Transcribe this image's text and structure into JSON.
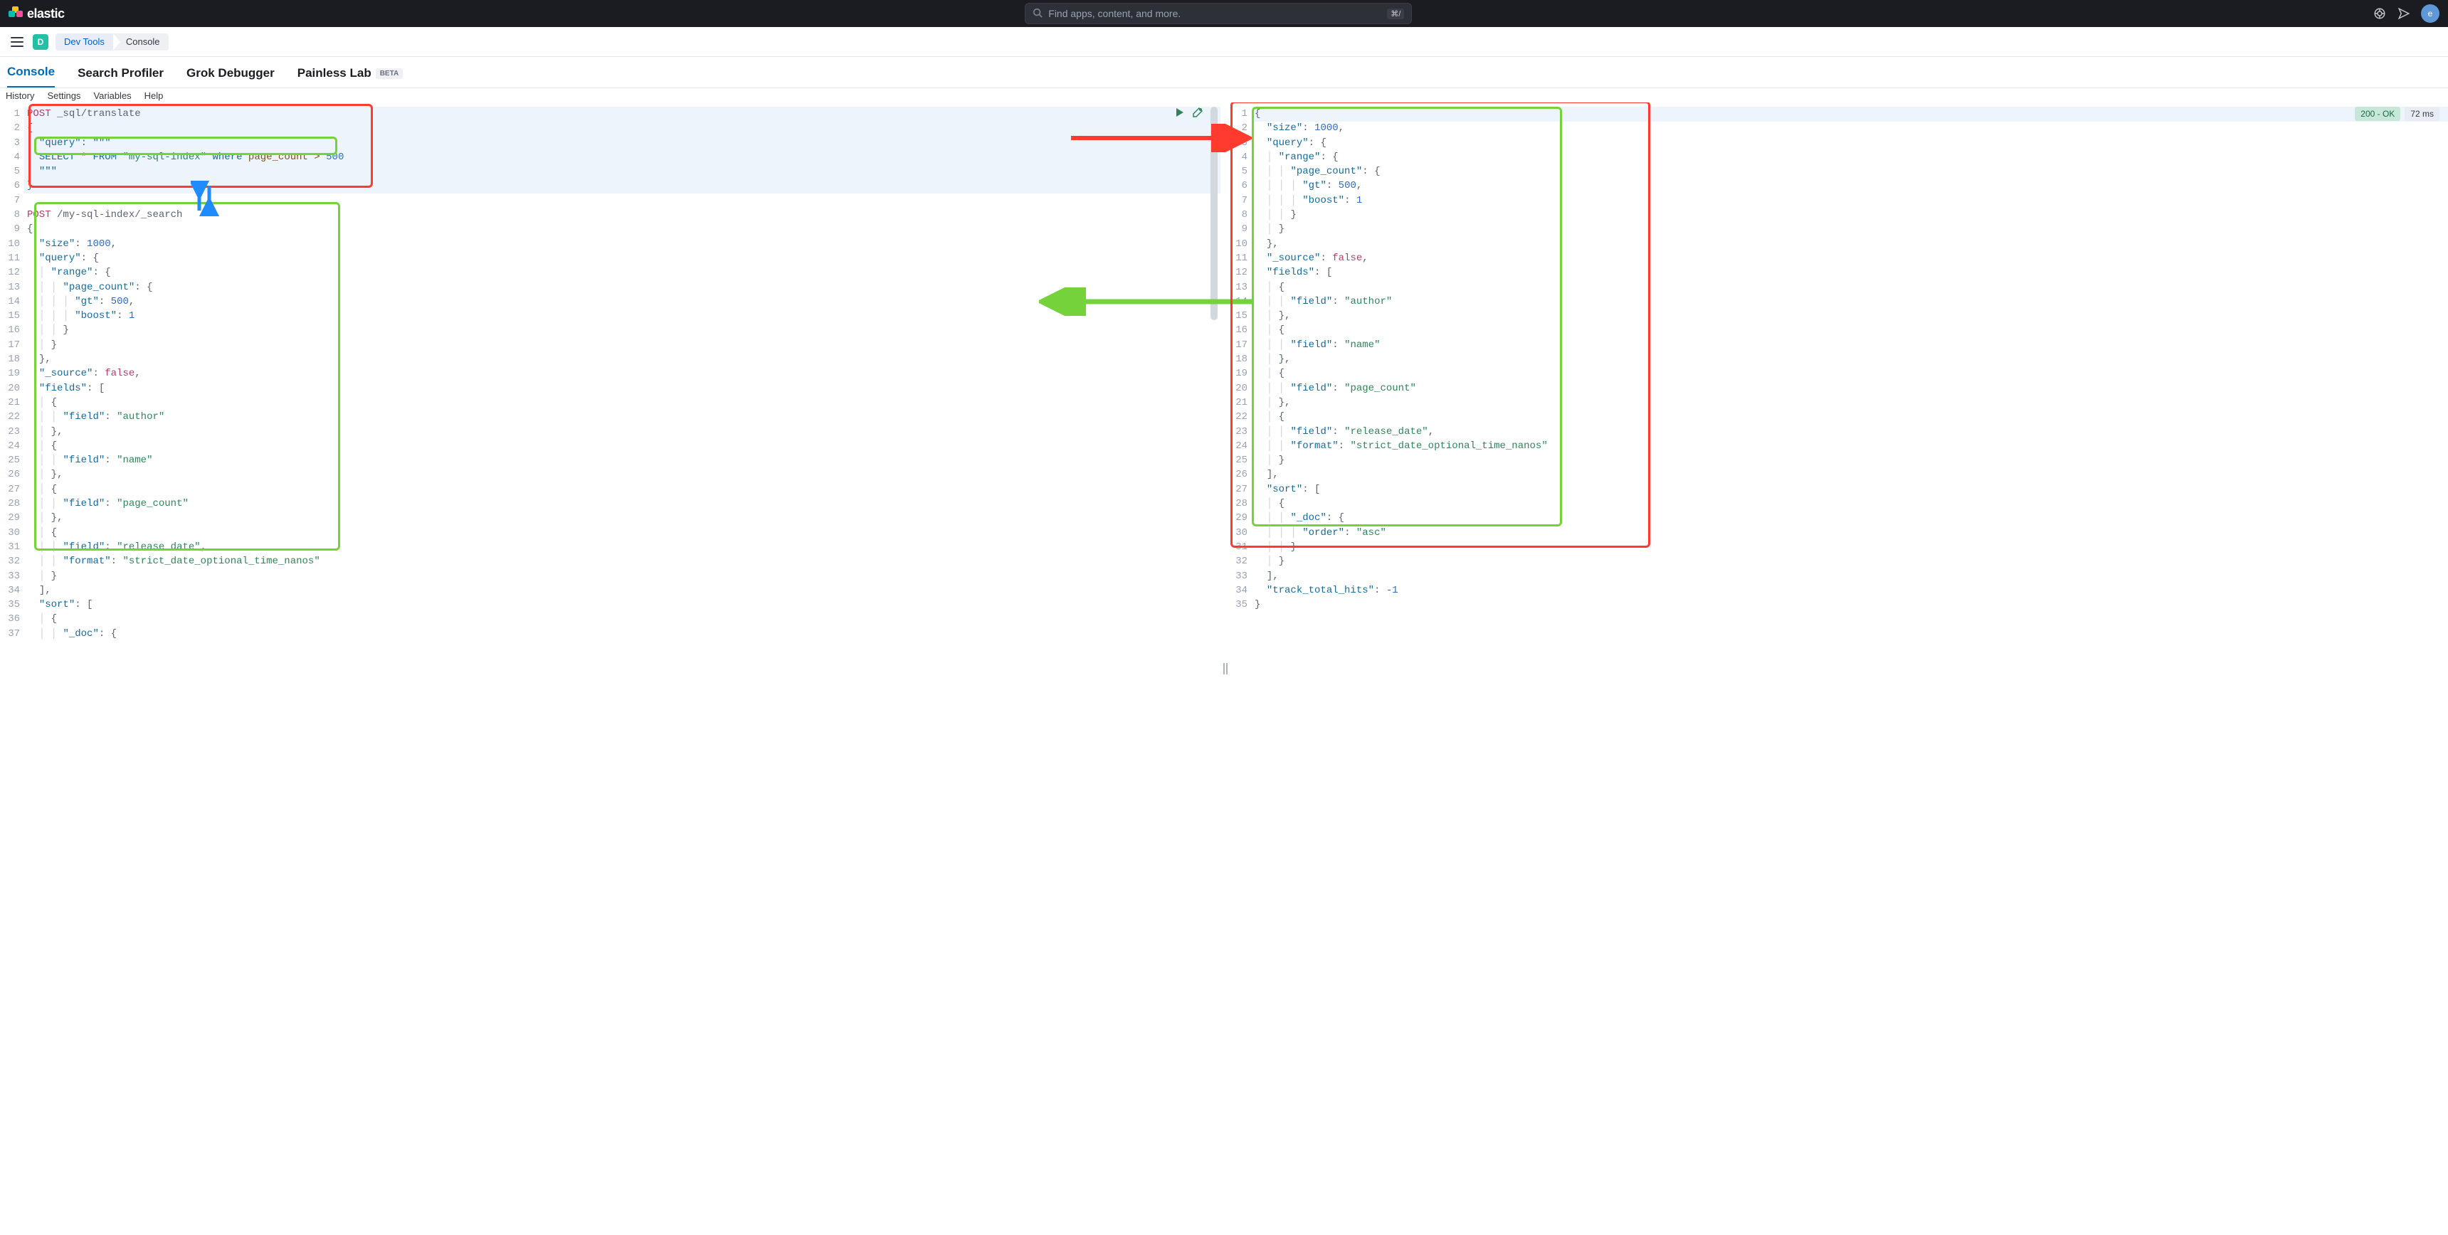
{
  "topbar": {
    "brand": "elastic",
    "search_placeholder": "Find apps, content, and more.",
    "kbd": "⌘/",
    "avatar_initial": "e"
  },
  "crumb": {
    "space_initial": "D",
    "devtools": "Dev Tools",
    "console": "Console"
  },
  "tabs": {
    "console": "Console",
    "profiler": "Search Profiler",
    "grok": "Grok Debugger",
    "painless": "Painless Lab",
    "beta": "BETA"
  },
  "subnav": {
    "history": "History",
    "settings": "Settings",
    "variables": "Variables",
    "help": "Help"
  },
  "status": {
    "code": "200 - OK",
    "time": "72 ms"
  },
  "editor_left": {
    "lines": [
      {
        "n": "1",
        "html": "<span class='tok-method'>POST</span> <span class='tok-url'>_sql/translate</span>"
      },
      {
        "n": "2",
        "html": "<span class='tok-brace'>{</span>"
      },
      {
        "n": "3",
        "html": "  <span class='tok-key'>\"query\"</span><span class='tok-punc'>:</span> <span class='tok-str'>\"\"\"</span>"
      },
      {
        "n": "4",
        "html": "  <span class='tok-kw'>SELECT</span> <span class='tok-op'>*</span> <span class='tok-kw'>FROM</span> <span class='tok-strg'>\"my-sql-index\"</span> <span class='tok-kw'>where</span> <span class='tok-ident'>page_count</span> <span class='tok-op'>&gt;</span> <span class='tok-num'>500</span>"
      },
      {
        "n": "5",
        "html": "  <span class='tok-str'>\"\"\"</span>"
      },
      {
        "n": "6",
        "html": "<span class='tok-brace'>}</span>"
      },
      {
        "n": "7",
        "html": ""
      },
      {
        "n": "8",
        "html": "<span class='tok-method'>POST</span> <span class='tok-url'>/my-sql-index/_search</span>"
      },
      {
        "n": "9",
        "html": "<span class='tok-brace'>{</span>"
      },
      {
        "n": "10",
        "html": "  <span class='tok-key'>\"size\"</span><span class='tok-punc'>:</span> <span class='tok-num'>1000</span><span class='tok-punc'>,</span>"
      },
      {
        "n": "11",
        "html": "  <span class='tok-key'>\"query\"</span><span class='tok-punc'>:</span> <span class='tok-brace'>{</span>"
      },
      {
        "n": "12",
        "html": "  <span class='guide'>│</span> <span class='tok-key'>\"range\"</span><span class='tok-punc'>:</span> <span class='tok-brace'>{</span>"
      },
      {
        "n": "13",
        "html": "  <span class='guide'>│</span> <span class='guide'>│</span> <span class='tok-key'>\"page_count\"</span><span class='tok-punc'>:</span> <span class='tok-brace'>{</span>"
      },
      {
        "n": "14",
        "html": "  <span class='guide'>│</span> <span class='guide'>│</span> <span class='guide'>│</span> <span class='tok-key'>\"gt\"</span><span class='tok-punc'>:</span> <span class='tok-num'>500</span><span class='tok-punc'>,</span>"
      },
      {
        "n": "15",
        "html": "  <span class='guide'>│</span> <span class='guide'>│</span> <span class='guide'>│</span> <span class='tok-key'>\"boost\"</span><span class='tok-punc'>:</span> <span class='tok-num'>1</span>"
      },
      {
        "n": "16",
        "html": "  <span class='guide'>│</span> <span class='guide'>│</span> <span class='tok-brace'>}</span>"
      },
      {
        "n": "17",
        "html": "  <span class='guide'>│</span> <span class='tok-brace'>}</span>"
      },
      {
        "n": "18",
        "html": "  <span class='tok-brace'>}</span><span class='tok-punc'>,</span>"
      },
      {
        "n": "19",
        "html": "  <span class='tok-key'>\"_source\"</span><span class='tok-punc'>:</span> <span class='tok-bool'>false</span><span class='tok-punc'>,</span>"
      },
      {
        "n": "20",
        "html": "  <span class='tok-key'>\"fields\"</span><span class='tok-punc'>:</span> <span class='tok-brace'>[</span>"
      },
      {
        "n": "21",
        "html": "  <span class='guide'>│</span> <span class='tok-brace'>{</span>"
      },
      {
        "n": "22",
        "html": "  <span class='guide'>│</span> <span class='guide'>│</span> <span class='tok-key'>\"field\"</span><span class='tok-punc'>:</span> <span class='tok-strg'>\"author\"</span>"
      },
      {
        "n": "23",
        "html": "  <span class='guide'>│</span> <span class='tok-brace'>}</span><span class='tok-punc'>,</span>"
      },
      {
        "n": "24",
        "html": "  <span class='guide'>│</span> <span class='tok-brace'>{</span>"
      },
      {
        "n": "25",
        "html": "  <span class='guide'>│</span> <span class='guide'>│</span> <span class='tok-key'>\"field\"</span><span class='tok-punc'>:</span> <span class='tok-strg'>\"name\"</span>"
      },
      {
        "n": "26",
        "html": "  <span class='guide'>│</span> <span class='tok-brace'>}</span><span class='tok-punc'>,</span>"
      },
      {
        "n": "27",
        "html": "  <span class='guide'>│</span> <span class='tok-brace'>{</span>"
      },
      {
        "n": "28",
        "html": "  <span class='guide'>│</span> <span class='guide'>│</span> <span class='tok-key'>\"field\"</span><span class='tok-punc'>:</span> <span class='tok-strg'>\"page_count\"</span>"
      },
      {
        "n": "29",
        "html": "  <span class='guide'>│</span> <span class='tok-brace'>}</span><span class='tok-punc'>,</span>"
      },
      {
        "n": "30",
        "html": "  <span class='guide'>│</span> <span class='tok-brace'>{</span>"
      },
      {
        "n": "31",
        "html": "  <span class='guide'>│</span> <span class='guide'>│</span> <span class='tok-key'>\"field\"</span><span class='tok-punc'>:</span> <span class='tok-strg'>\"release_date\"</span><span class='tok-punc'>,</span>"
      },
      {
        "n": "32",
        "html": "  <span class='guide'>│</span> <span class='guide'>│</span> <span class='tok-key'>\"format\"</span><span class='tok-punc'>:</span> <span class='tok-strg'>\"strict_date_optional_time_nanos\"</span>"
      },
      {
        "n": "33",
        "html": "  <span class='guide'>│</span> <span class='tok-brace'>}</span>"
      },
      {
        "n": "34",
        "html": "  <span class='tok-brace'>]</span><span class='tok-punc'>,</span>"
      },
      {
        "n": "35",
        "html": "  <span class='tok-key'>\"sort\"</span><span class='tok-punc'>:</span> <span class='tok-brace'>[</span>"
      },
      {
        "n": "36",
        "html": "  <span class='guide'>│</span> <span class='tok-brace'>{</span>"
      },
      {
        "n": "37",
        "html": "  <span class='guide'>│</span> <span class='guide'>│</span> <span class='tok-key'>\"_doc\"</span><span class='tok-punc'>:</span> <span class='tok-brace'>{</span>"
      }
    ]
  },
  "editor_right": {
    "lines": [
      {
        "n": "1",
        "html": "<span class='tok-brace'>{</span>"
      },
      {
        "n": "2",
        "html": "  <span class='tok-key'>\"size\"</span><span class='tok-punc'>:</span> <span class='tok-num'>1000</span><span class='tok-punc'>,</span>"
      },
      {
        "n": "3",
        "html": "  <span class='tok-key'>\"query\"</span><span class='tok-punc'>:</span> <span class='tok-brace'>{</span>"
      },
      {
        "n": "4",
        "html": "  <span class='guide'>│</span> <span class='tok-key'>\"range\"</span><span class='tok-punc'>:</span> <span class='tok-brace'>{</span>"
      },
      {
        "n": "5",
        "html": "  <span class='guide'>│</span> <span class='guide'>│</span> <span class='tok-key'>\"page_count\"</span><span class='tok-punc'>:</span> <span class='tok-brace'>{</span>"
      },
      {
        "n": "6",
        "html": "  <span class='guide'>│</span> <span class='guide'>│</span> <span class='guide'>│</span> <span class='tok-key'>\"gt\"</span><span class='tok-punc'>:</span> <span class='tok-num'>500</span><span class='tok-punc'>,</span>"
      },
      {
        "n": "7",
        "html": "  <span class='guide'>│</span> <span class='guide'>│</span> <span class='guide'>│</span> <span class='tok-key'>\"boost\"</span><span class='tok-punc'>:</span> <span class='tok-num'>1</span>"
      },
      {
        "n": "8",
        "html": "  <span class='guide'>│</span> <span class='guide'>│</span> <span class='tok-brace'>}</span>"
      },
      {
        "n": "9",
        "html": "  <span class='guide'>│</span> <span class='tok-brace'>}</span>"
      },
      {
        "n": "10",
        "html": "  <span class='tok-brace'>}</span><span class='tok-punc'>,</span>"
      },
      {
        "n": "11",
        "html": "  <span class='tok-key'>\"_source\"</span><span class='tok-punc'>:</span> <span class='tok-bool'>false</span><span class='tok-punc'>,</span>"
      },
      {
        "n": "12",
        "html": "  <span class='tok-key'>\"fields\"</span><span class='tok-punc'>:</span> <span class='tok-brace'>[</span>"
      },
      {
        "n": "13",
        "html": "  <span class='guide'>│</span> <span class='tok-brace'>{</span>"
      },
      {
        "n": "14",
        "html": "  <span class='guide'>│</span> <span class='guide'>│</span> <span class='tok-key'>\"field\"</span><span class='tok-punc'>:</span> <span class='tok-strg'>\"author\"</span>"
      },
      {
        "n": "15",
        "html": "  <span class='guide'>│</span> <span class='tok-brace'>}</span><span class='tok-punc'>,</span>"
      },
      {
        "n": "16",
        "html": "  <span class='guide'>│</span> <span class='tok-brace'>{</span>"
      },
      {
        "n": "17",
        "html": "  <span class='guide'>│</span> <span class='guide'>│</span> <span class='tok-key'>\"field\"</span><span class='tok-punc'>:</span> <span class='tok-strg'>\"name\"</span>"
      },
      {
        "n": "18",
        "html": "  <span class='guide'>│</span> <span class='tok-brace'>}</span><span class='tok-punc'>,</span>"
      },
      {
        "n": "19",
        "html": "  <span class='guide'>│</span> <span class='tok-brace'>{</span>"
      },
      {
        "n": "20",
        "html": "  <span class='guide'>│</span> <span class='guide'>│</span> <span class='tok-key'>\"field\"</span><span class='tok-punc'>:</span> <span class='tok-strg'>\"page_count\"</span>"
      },
      {
        "n": "21",
        "html": "  <span class='guide'>│</span> <span class='tok-brace'>}</span><span class='tok-punc'>,</span>"
      },
      {
        "n": "22",
        "html": "  <span class='guide'>│</span> <span class='tok-brace'>{</span>"
      },
      {
        "n": "23",
        "html": "  <span class='guide'>│</span> <span class='guide'>│</span> <span class='tok-key'>\"field\"</span><span class='tok-punc'>:</span> <span class='tok-strg'>\"release_date\"</span><span class='tok-punc'>,</span>"
      },
      {
        "n": "24",
        "html": "  <span class='guide'>│</span> <span class='guide'>│</span> <span class='tok-key'>\"format\"</span><span class='tok-punc'>:</span> <span class='tok-strg'>\"strict_date_optional_time_nanos\"</span>"
      },
      {
        "n": "25",
        "html": "  <span class='guide'>│</span> <span class='tok-brace'>}</span>"
      },
      {
        "n": "26",
        "html": "  <span class='tok-brace'>]</span><span class='tok-punc'>,</span>"
      },
      {
        "n": "27",
        "html": "  <span class='tok-key'>\"sort\"</span><span class='tok-punc'>:</span> <span class='tok-brace'>[</span>"
      },
      {
        "n": "28",
        "html": "  <span class='guide'>│</span> <span class='tok-brace'>{</span>"
      },
      {
        "n": "29",
        "html": "  <span class='guide'>│</span> <span class='guide'>│</span> <span class='tok-key'>\"_doc\"</span><span class='tok-punc'>:</span> <span class='tok-brace'>{</span>"
      },
      {
        "n": "30",
        "html": "  <span class='guide'>│</span> <span class='guide'>│</span> <span class='guide'>│</span> <span class='tok-key'>\"order\"</span><span class='tok-punc'>:</span> <span class='tok-strg'>\"asc\"</span>"
      },
      {
        "n": "31",
        "html": "  <span class='guide'>│</span> <span class='guide'>│</span> <span class='tok-brace'>}</span>"
      },
      {
        "n": "32",
        "html": "  <span class='guide'>│</span> <span class='tok-brace'>}</span>"
      },
      {
        "n": "33",
        "html": "  <span class='tok-brace'>]</span><span class='tok-punc'>,</span>"
      },
      {
        "n": "34",
        "html": "  <span class='tok-key'>\"track_total_hits\"</span><span class='tok-punc'>:</span> <span class='tok-num'>-1</span>"
      },
      {
        "n": "35",
        "html": "<span class='tok-brace'>}</span>"
      }
    ]
  }
}
